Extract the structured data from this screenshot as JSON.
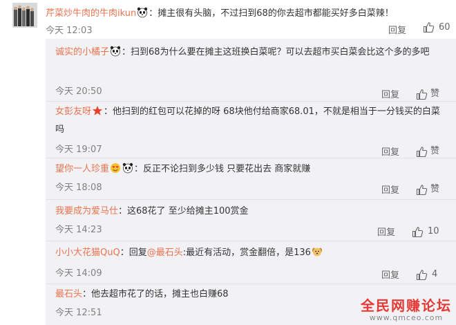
{
  "top_comment": {
    "username": "芹菜炒牛肉的牛肉ikun",
    "text": "：摊主很有头脑，不过扫到68的你去超市都能买好多白菜辣！",
    "time": "今天 12:03",
    "reply_label": "回复",
    "like_count": "60"
  },
  "replies": [
    {
      "username": "诚实的小橘子",
      "text": "：扫到68为什么要在摊主这班换白菜呢？可以去超市买白菜会比这个多的多吧",
      "time": "今天 20:50",
      "reply_label": "回复",
      "like_label": "赞"
    },
    {
      "username": "女彭友呀",
      "text": "：他扫到的红包可以花掉的呀 68块他付给商家68.01，不就是相当于一分钱买的白菜吗",
      "time": "今天 19:07",
      "reply_label": "回复",
      "like_label": "赞"
    },
    {
      "username": "望你一人珍重",
      "text": "：反正不论扫到多少钱 只要花出去 商家就赚",
      "time": "今天 18:08",
      "reply_label": "回复",
      "like_label": "赞"
    },
    {
      "username": "我要成为爱马仕",
      "text": "：这68花了 至少给摊主100赏金",
      "time": "今天 14:23",
      "reply_label": "回复",
      "like_label": "10"
    },
    {
      "username": "小小大花猫QuQ",
      "text_prefix": "：回复",
      "mention": "@最石头",
      "text": ":最近有活动，赏金翻倍，是136",
      "time": "今天 14:09",
      "reply_label": "回复",
      "like_label": "4"
    },
    {
      "username": "最石头",
      "text": "：他去超市花了的话，摊主也白赚68",
      "time": "今天 12:51"
    }
  ],
  "watermark": {
    "title": "全民网赚论坛",
    "url": "www.qmceo.com"
  },
  "colors": {
    "username": "#eb7350",
    "panel_bg": "#f2f2f5",
    "time": "#808080",
    "watermark": "#e53935"
  },
  "icons": [
    "panda-emoji-icon",
    "red-star-icon",
    "heart-eyes-emoji-icon",
    "dog-emoji-icon",
    "thumbs-up-icon"
  ]
}
